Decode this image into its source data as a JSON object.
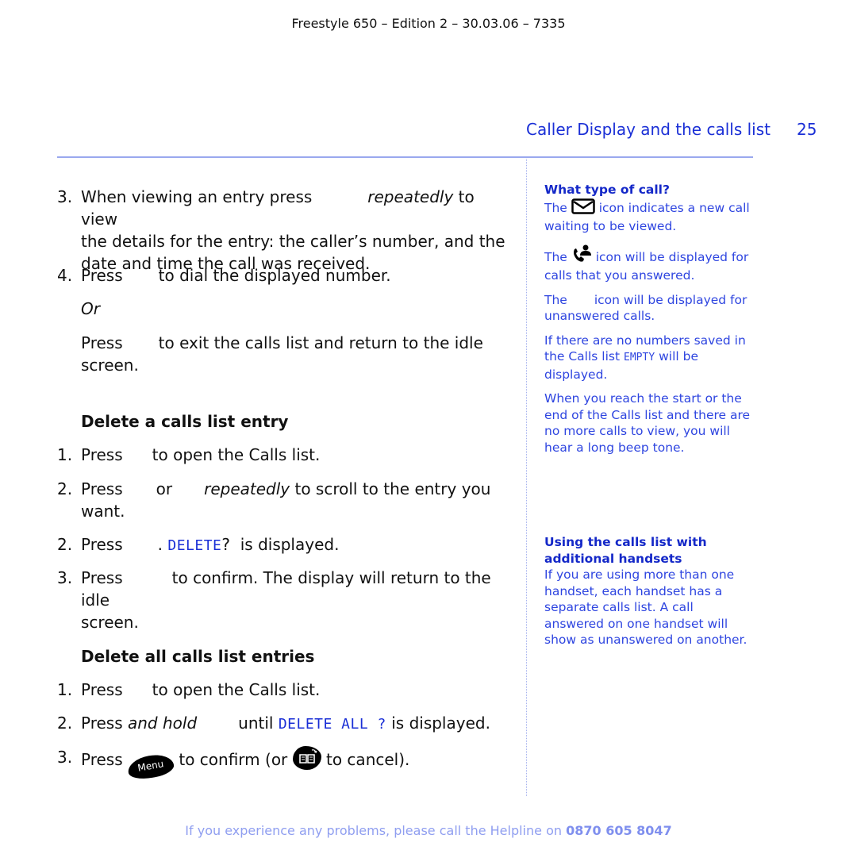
{
  "header": {
    "edition": "Freestyle 650 – Edition 2 – 30.03.06 – 7335",
    "chapter_title": "Caller Display and the calls list",
    "page_number": "25"
  },
  "main": {
    "step3_view": {
      "num": "3.",
      "line1_a": "When viewing an entry press",
      "line1_em": "repeatedly",
      "line1_b": " to view",
      "line2": "the details for the entry: the caller’s number, and the",
      "line3": "date and time the call was received."
    },
    "step4_dial": {
      "num": "4.",
      "press": "Press",
      "rest": "to dial the displayed number."
    },
    "or_label": "Or",
    "exit": {
      "press": "Press",
      "rest": "to exit the calls list and return to the idle",
      "line2": "screen."
    },
    "section1": {
      "heading": "Delete a calls list entry",
      "step1": {
        "num": "1.",
        "press": "Press",
        "rest": "to open the Calls list."
      },
      "step2": {
        "num": "2.",
        "press": "Press",
        "or": "or",
        "em": "repeatedly",
        "rest": " to scroll to the entry you",
        "line2": "want."
      },
      "step2b": {
        "num": "2.",
        "press": "Press",
        "dot": ".",
        "lcd": "DELETE",
        "q": "?",
        "rest": "is displayed."
      },
      "step3": {
        "num": "3.",
        "press": "Press",
        "rest": "to confirm. The display will return to the idle",
        "line2": "screen."
      }
    },
    "section2": {
      "heading": "Delete all calls list entries",
      "step1": {
        "num": "1.",
        "press": "Press",
        "rest": "to open the Calls list."
      },
      "step2": {
        "num": "2.",
        "press": "Press",
        "em": "and hold",
        "until": "until",
        "lcd": "DELETE ALL ?",
        "rest": "is displayed."
      },
      "step3": {
        "num": "3.",
        "press": "Press",
        "menu_key": "Menu",
        "mid": "to confirm (or",
        "end": "to cancel)."
      }
    }
  },
  "sidebar": {
    "heading1": "What type of call?",
    "p1_a": "The",
    "p1_b": "icon indicates a new call",
    "p1_c": "waiting to be viewed.",
    "p2_a": "The",
    "p2_b": "icon will be displayed for",
    "p2_c": "calls that you answered.",
    "p3_a": "The",
    "p3_b": "icon will be displayed for",
    "p3_c": "unanswered calls.",
    "p4_a": "If there are no numbers saved in",
    "p4_b": "the Calls list",
    "p4_lcd": "EMPTY",
    "p4_c": "will be",
    "p4_d": "displayed.",
    "p5": "When you reach the start or the end of the Calls list and there are no more calls to view, you will hear a long beep tone.",
    "heading2": "Using the calls list with additional handsets",
    "p6": "If you are using more than one handset, each handset has a separate calls list. A call answered on one handset will show as unanswered on another."
  },
  "footer": {
    "text": "If you experience any problems, please call the Helpline on",
    "phone": "0870 605 8047"
  },
  "colors": {
    "accent": "#1a2fd6",
    "sidebar_text": "#2e45e0",
    "rule": "#9aa8ee",
    "footer": "#8f9ef0"
  }
}
